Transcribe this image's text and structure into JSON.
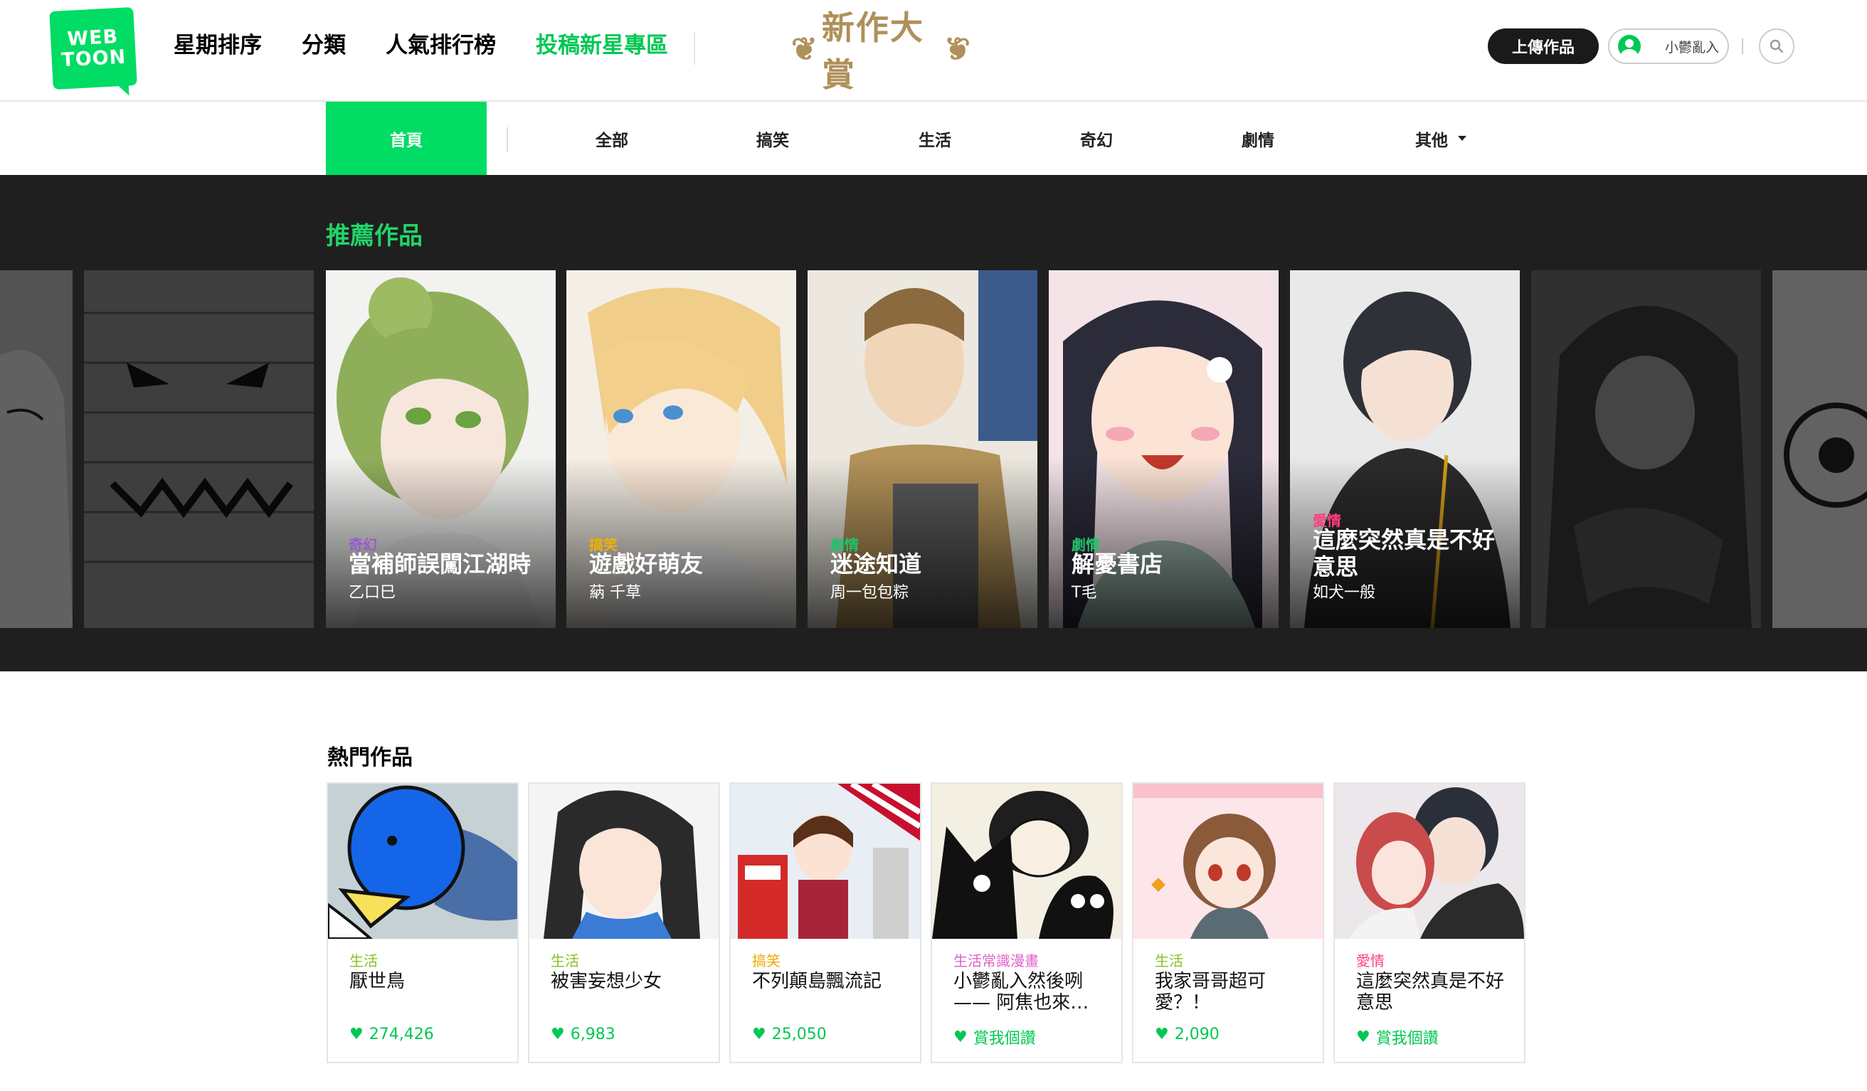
{
  "header": {
    "logo_line1": "WEB",
    "logo_line2": "TOON",
    "nav": [
      "星期排序",
      "分類",
      "人氣排行榜",
      "投稿新星專區"
    ],
    "award": "新作大賞",
    "upload_label": "上傳作品",
    "user_label": "小鬱亂入",
    "search_icon": "search-icon",
    "accent_color": "#00dc64"
  },
  "subnav": {
    "home": "首頁",
    "items": [
      "全部",
      "搞笑",
      "生活",
      "奇幻",
      "劇情",
      "其他"
    ]
  },
  "recommend": {
    "title": "推薦作品",
    "cards": [
      {
        "genre": "奇幻",
        "name": "當補師誤闖江湖時",
        "author": "乙口巳",
        "genre_color": "#9b59d0"
      },
      {
        "genre": "搞笑",
        "name": "遊戲好萌友",
        "author": "蒳 千草",
        "genre_color": "#f0b000"
      },
      {
        "genre": "劇情",
        "name": "迷途知道",
        "author": "周一包包粽",
        "genre_color": "#22c26a"
      },
      {
        "genre": "劇情",
        "name": "解憂書店",
        "author": "T毛",
        "genre_color": "#22c26a"
      },
      {
        "genre": "愛情",
        "name": "這麼突然真是不好意思",
        "author": "如犬一般",
        "genre_color": "#ff3d7f"
      }
    ]
  },
  "hot": {
    "title": "熱門作品",
    "cards": [
      {
        "genre": "生活",
        "name": "厭世鳥",
        "likes": "274,426",
        "genre_color": "#8bbf24"
      },
      {
        "genre": "生活",
        "name": "被害妄想少女",
        "likes": "6,983",
        "genre_color": "#8bbf24"
      },
      {
        "genre": "搞笑",
        "name": "不列顛島飄流記",
        "likes": "25,050",
        "genre_color": "#f0a800"
      },
      {
        "genre": "生活常識漫畫",
        "name": "小鬱亂入然後咧—— 阿焦也來…",
        "likes": "賞我個讚",
        "genre_color": "#e060c8"
      },
      {
        "genre": "生活",
        "name": "我家哥哥超可愛？！",
        "likes": "2,090",
        "genre_color": "#8bbf24"
      },
      {
        "genre": "愛情",
        "name": "這麼突然真是不好意思",
        "likes": "賞我個讚",
        "genre_color": "#ff3d7f"
      }
    ]
  }
}
